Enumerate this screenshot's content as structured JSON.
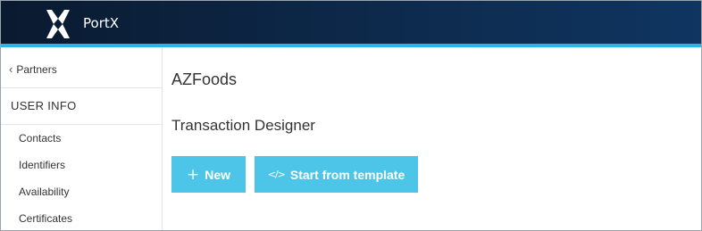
{
  "header": {
    "brand": "PortX",
    "logo_icon": "portx-logo-icon",
    "accent_color": "#2bb5e0"
  },
  "sidebar": {
    "back_label": "Partners",
    "section_title": "USER INFO",
    "items": [
      {
        "label": "Contacts"
      },
      {
        "label": "Identifiers"
      },
      {
        "label": "Availability"
      },
      {
        "label": "Certificates"
      }
    ]
  },
  "main": {
    "title": "AZFoods",
    "section_heading": "Transaction Designer",
    "buttons": {
      "new_label": "New",
      "new_icon": "plus-icon",
      "template_label": "Start from template",
      "template_icon": "code-icon",
      "button_color": "#4dc5e8"
    }
  }
}
